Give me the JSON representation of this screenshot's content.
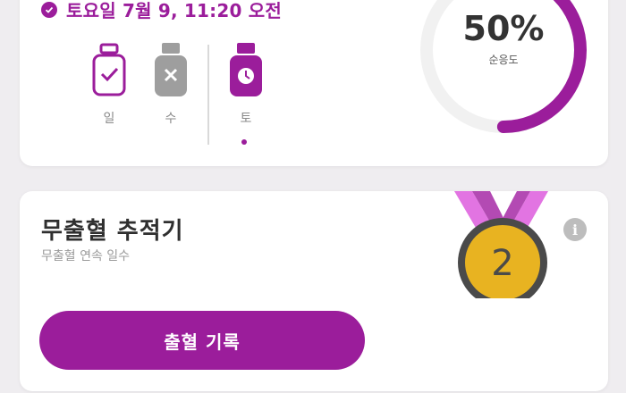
{
  "summary": {
    "date": "토요일 7월 9, 11:20 오전",
    "days": [
      {
        "label": "일",
        "status": "taken",
        "icon": "pill-bottle-check-icon"
      },
      {
        "label": "수",
        "status": "missed",
        "icon": "pill-bottle-x-icon"
      },
      {
        "label": "토",
        "status": "scheduled",
        "icon": "pill-bottle-clock-icon"
      }
    ],
    "compliance_value": 0.5,
    "compliance_percent": "50%",
    "compliance_label": "순응도"
  },
  "tracker": {
    "title": "무출혈 추적기",
    "subtitle": "무출혈 연속 일수",
    "medal_value": "2",
    "button_label": "출혈 기록"
  },
  "colors": {
    "accent": "#9b1d9b",
    "medal_gold": "#e8b321",
    "ribbon_pink": "#e274e2"
  }
}
